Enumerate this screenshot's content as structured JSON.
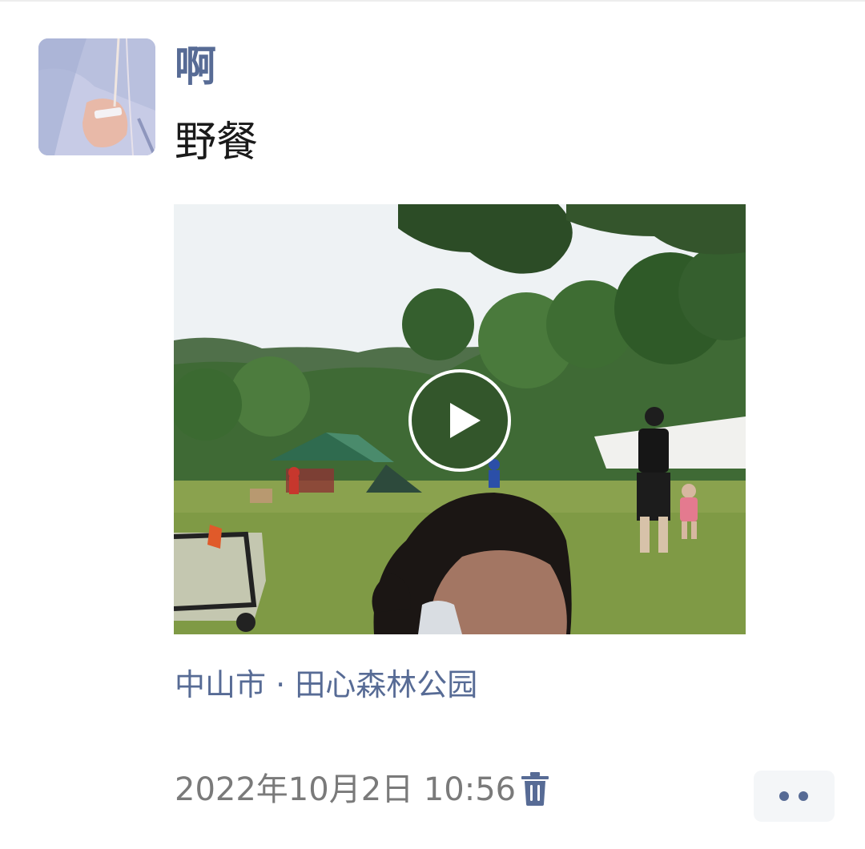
{
  "post": {
    "author": "啊",
    "text": "野餐",
    "location": "中山市 · 田心森林公园",
    "timestamp": "2022年10月2日 10:56"
  },
  "media": {
    "type": "video",
    "thumbnail_icon": "play-icon"
  },
  "icons": {
    "delete": "trash-icon",
    "more": "more-dots-icon"
  },
  "colors": {
    "link": "#576b95",
    "timestamp": "#7a7a7a",
    "text": "#1a1a1a",
    "more_bg": "#f4f6f8"
  }
}
